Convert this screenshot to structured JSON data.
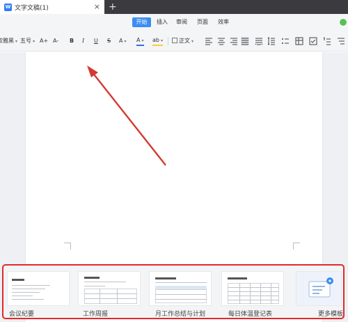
{
  "titlebar": {
    "doc_icon_text": "W",
    "document_tab": "文字文稿(1)",
    "close_glyph": "×",
    "new_tab_glyph": "+"
  },
  "ribbon": {
    "tabs": [
      {
        "label": "开始",
        "active": true
      },
      {
        "label": "插入",
        "active": false
      },
      {
        "label": "审阅",
        "active": false
      },
      {
        "label": "页面",
        "active": false
      },
      {
        "label": "效率",
        "active": false
      }
    ],
    "accent_color": "#3c8df0"
  },
  "toolbar": {
    "font_name": "微软雅黑",
    "font_size": "五号",
    "grow_font": "A+",
    "shrink_font": "A-",
    "bold": "B",
    "italic": "I",
    "underline": "U",
    "strike": "S",
    "text_effect": "A",
    "font_color": "A",
    "highlight": "ab",
    "style_label": "正文"
  },
  "templates": {
    "items": [
      {
        "label": "会议纪要",
        "icon": "meeting-minutes-template"
      },
      {
        "label": "工作周报",
        "icon": "weekly-report-template"
      },
      {
        "label": "月工作总结与计划",
        "icon": "monthly-summary-template"
      },
      {
        "label": "每日体温登记表",
        "icon": "temperature-log-template"
      },
      {
        "label": "更多模板",
        "icon": "more-templates"
      }
    ],
    "highlight_color": "#e02a2a"
  },
  "annotation": {
    "arrow_color": "#d23a32"
  }
}
